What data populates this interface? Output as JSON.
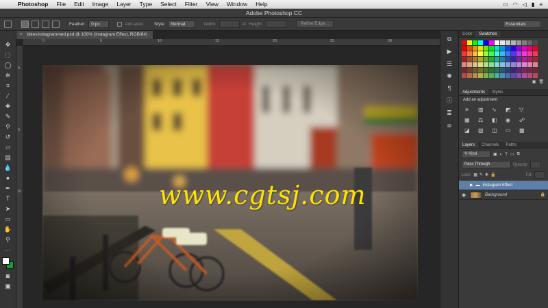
{
  "menubar": {
    "items": [
      "Photoshop",
      "File",
      "Edit",
      "Image",
      "Layer",
      "Type",
      "Select",
      "Filter",
      "View",
      "Window",
      "Help"
    ],
    "right_icons": [
      "display-icon",
      "wifi-icon",
      "volume-icon",
      "battery-icon",
      "menu-extra-icon"
    ]
  },
  "window_title": "Adobe Photoshop CC",
  "options_bar": {
    "feather_label": "Feather:",
    "feather_value": "0 px",
    "antialias_label": "Anti-alias",
    "style_label": "Style:",
    "style_value": "Normal",
    "width_label": "Width:",
    "height_label": "Height:",
    "refine_edge": "Refine Edge...",
    "workspace": "Essentials"
  },
  "document": {
    "tab_title": "bikesInstagrammed.psd @ 100% (Instagram Effect, RGB/8#)",
    "ruler_marks": [
      "0",
      "5",
      "10",
      "15",
      "20",
      "25",
      "30"
    ],
    "ruler_v_marks": [
      "0",
      "5",
      "10"
    ],
    "watermark": "www.cgtsj.com"
  },
  "swatches_panel": {
    "tabs": [
      "Color",
      "Swatches"
    ],
    "active": "Swatches"
  },
  "adjustments_panel": {
    "tabs": [
      "Adjustments",
      "Styles"
    ],
    "heading": "Add an adjustment"
  },
  "layers_panel": {
    "tabs": [
      "Layers",
      "Channels",
      "Paths"
    ],
    "filter_kind": "Kind",
    "blend_mode": "Pass Through",
    "opacity_label": "Opacity:",
    "lock_label": "Lock:",
    "fill_label": "Fill:",
    "layers": [
      {
        "name": "Instagram Effect",
        "selected": true
      },
      {
        "name": "Background",
        "selected": false
      }
    ]
  },
  "colors": {
    "accent_selected_layer": "#5d7fa8",
    "watermark": "#ffe200"
  }
}
